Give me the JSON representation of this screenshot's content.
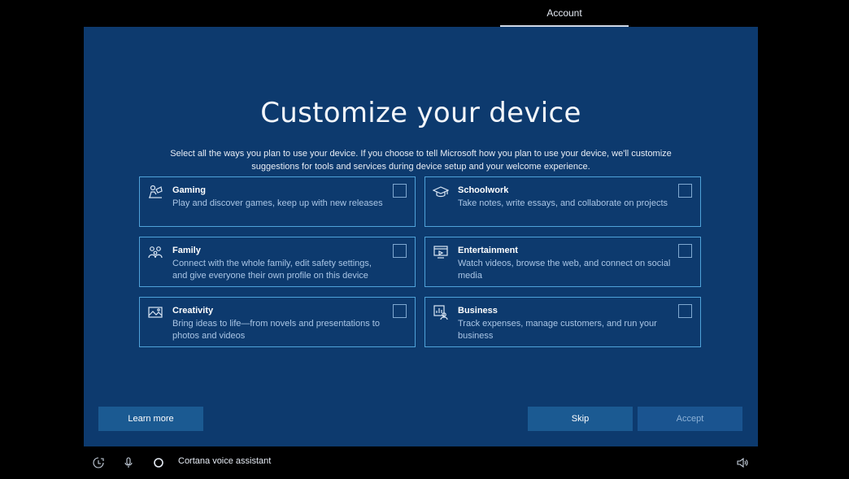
{
  "header": {
    "tab_label": "Account"
  },
  "main": {
    "title": "Customize your device",
    "subtitle": "Select all the ways you plan to use your device. If you choose to tell Microsoft how you plan to use your device, we'll customize suggestions for tools and services during device setup and your welcome experience.",
    "cards": [
      {
        "icon": "gaming-icon",
        "title": "Gaming",
        "description": "Play and discover games, keep up with new releases",
        "checked": false
      },
      {
        "icon": "schoolwork-icon",
        "title": "Schoolwork",
        "description": "Take notes, write essays, and collaborate on projects",
        "checked": false
      },
      {
        "icon": "family-icon",
        "title": "Family",
        "description": "Connect with the whole family, edit safety settings, and give everyone their own profile on this device",
        "checked": false
      },
      {
        "icon": "entertainment-icon",
        "title": "Entertainment",
        "description": "Watch videos, browse the web, and connect on social media",
        "checked": false
      },
      {
        "icon": "creativity-icon",
        "title": "Creativity",
        "description": "Bring ideas to life—from novels and presentations to photos and videos",
        "checked": false
      },
      {
        "icon": "business-icon",
        "title": "Business",
        "description": "Track expenses, manage customers, and run your business",
        "checked": false
      }
    ],
    "buttons": {
      "learn_more": "Learn more",
      "skip": "Skip",
      "accept": "Accept"
    }
  },
  "taskbar": {
    "cortana_label": "Cortana voice assistant"
  },
  "colors": {
    "panel": "#0d3a6e",
    "card_border": "#4fa2d9",
    "button": "#1b5a92",
    "background": "#000000"
  }
}
